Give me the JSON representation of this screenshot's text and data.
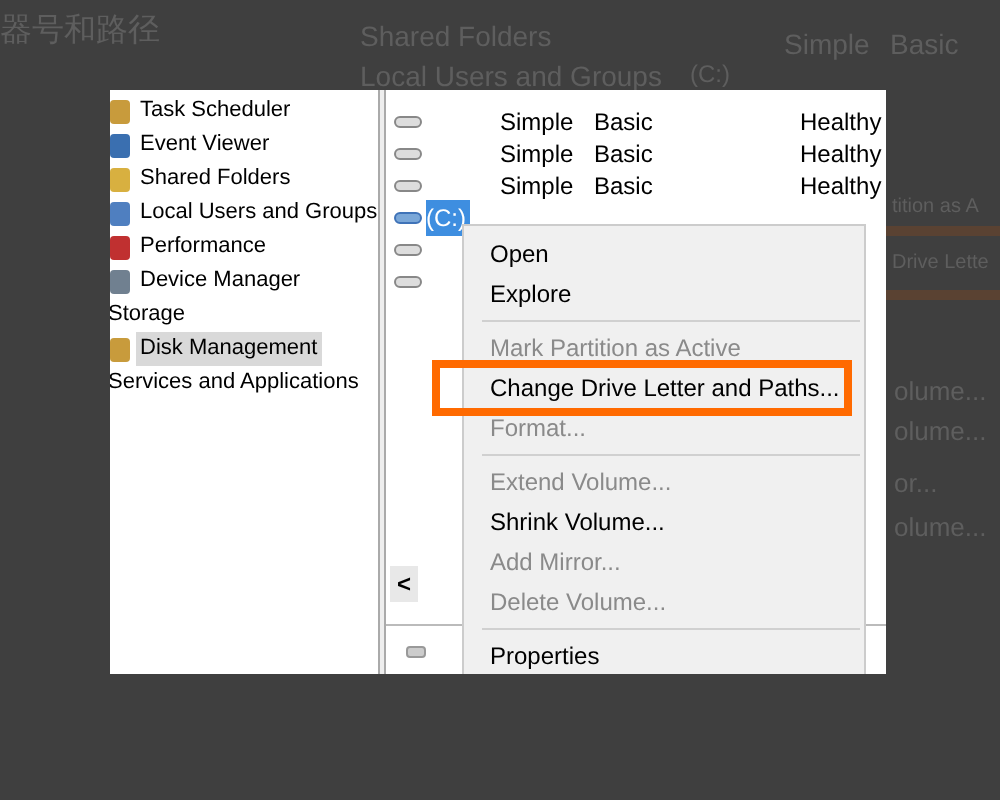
{
  "background": {
    "texts": [
      "器号和路径",
      "Shared Folders",
      "Local Users and Groups",
      "Simple",
      "Basic",
      "(C:)",
      "tition as A",
      "Drive Lette",
      "olume...",
      "olume...",
      "or...",
      "olume..."
    ]
  },
  "tree": {
    "items": [
      {
        "label": "Task Scheduler",
        "kind": "tool",
        "selected": false
      },
      {
        "label": "Event Viewer",
        "kind": "tool",
        "selected": false
      },
      {
        "label": "Shared Folders",
        "kind": "tool",
        "selected": false
      },
      {
        "label": "Local Users and Groups",
        "kind": "tool",
        "selected": false
      },
      {
        "label": "Performance",
        "kind": "tool",
        "selected": false
      },
      {
        "label": "Device Manager",
        "kind": "tool",
        "selected": false
      },
      {
        "label": "Storage",
        "kind": "group",
        "selected": false
      },
      {
        "label": "Disk Management",
        "kind": "tool",
        "selected": true
      },
      {
        "label": "Services and Applications",
        "kind": "group",
        "selected": false
      }
    ]
  },
  "volumes": [
    {
      "layout": "Simple",
      "type": "Basic",
      "status": "Healthy",
      "selected": false
    },
    {
      "layout": "Simple",
      "type": "Basic",
      "status": "Healthy",
      "selected": false
    },
    {
      "layout": "Simple",
      "type": "Basic",
      "status": "Healthy",
      "selected": false
    },
    {
      "name": "(C:)",
      "selected": true
    },
    {
      "selected": false
    },
    {
      "selected": false
    }
  ],
  "context_menu": {
    "items": [
      {
        "kind": "item",
        "label": "Open",
        "disabled": false,
        "highlighted": false
      },
      {
        "kind": "item",
        "label": "Explore",
        "disabled": false,
        "highlighted": false
      },
      {
        "kind": "separator"
      },
      {
        "kind": "item",
        "label": "Mark Partition as Active",
        "disabled": true,
        "highlighted": false
      },
      {
        "kind": "item",
        "label": "Change Drive Letter and Paths...",
        "disabled": false,
        "highlighted": true
      },
      {
        "kind": "item",
        "label": "Format...",
        "disabled": true,
        "highlighted": false
      },
      {
        "kind": "separator"
      },
      {
        "kind": "item",
        "label": "Extend Volume...",
        "disabled": true,
        "highlighted": false
      },
      {
        "kind": "item",
        "label": "Shrink Volume...",
        "disabled": false,
        "highlighted": false
      },
      {
        "kind": "item",
        "label": "Add Mirror...",
        "disabled": true,
        "highlighted": false
      },
      {
        "kind": "item",
        "label": "Delete Volume...",
        "disabled": true,
        "highlighted": false
      },
      {
        "kind": "separator"
      },
      {
        "kind": "item",
        "label": "Properties",
        "disabled": false,
        "highlighted": false
      }
    ]
  },
  "scroll_left": "<"
}
